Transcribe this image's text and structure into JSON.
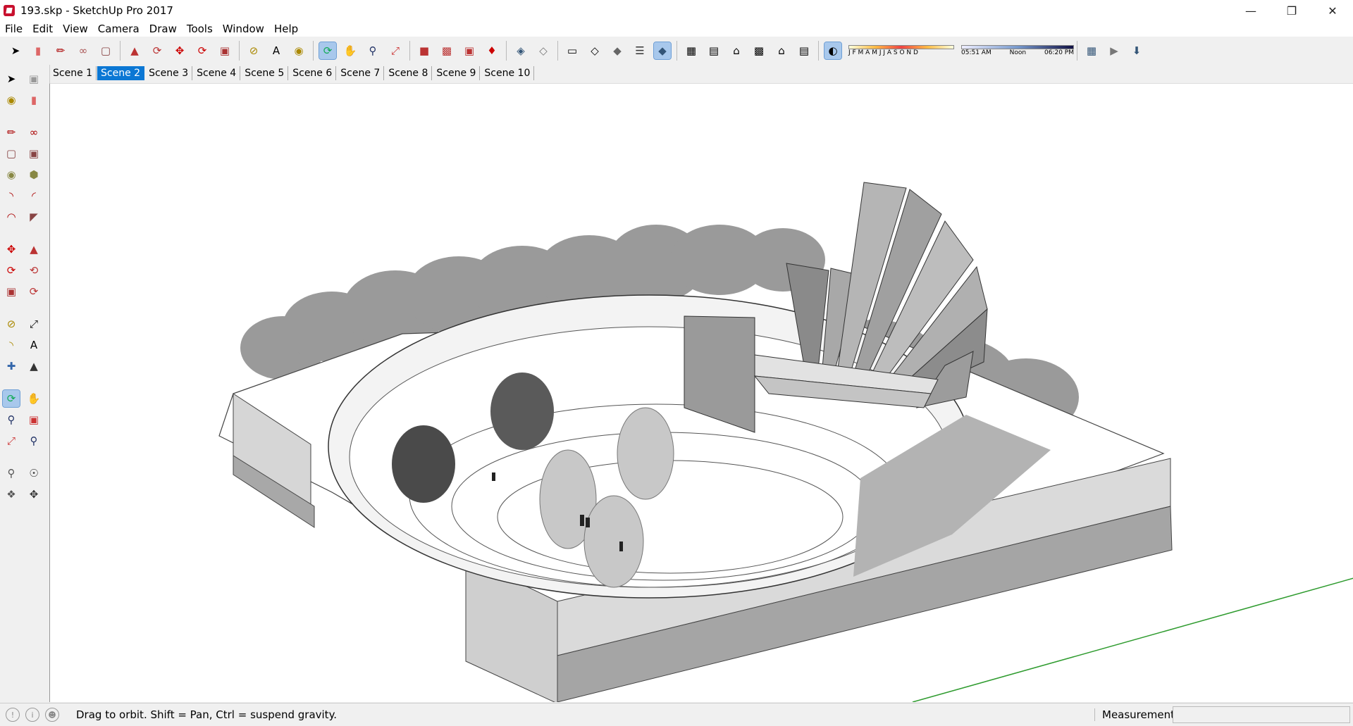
{
  "window": {
    "title": "193.skp - SketchUp Pro 2017"
  },
  "menu": [
    "File",
    "Edit",
    "View",
    "Camera",
    "Draw",
    "Tools",
    "Window",
    "Help"
  ],
  "scenes": {
    "tabs": [
      "Scene 1",
      "Scene 2",
      "Scene 3",
      "Scene 4",
      "Scene 5",
      "Scene 6",
      "Scene 7",
      "Scene 8",
      "Scene 9",
      "Scene 10"
    ],
    "active_index": 1
  },
  "shadow": {
    "months": "J F M A M J J A S O N D",
    "time_start": "05:51 AM",
    "time_noon": "Noon",
    "time_end": "06:20 PM"
  },
  "status": {
    "hint": "Drag to orbit. Shift = Pan, Ctrl = suspend gravity.",
    "measurements_label": "Measurements",
    "measurements_value": ""
  },
  "colors": {
    "active_tab": "#0b77d4",
    "selected_tool": "#a8c8ec",
    "axis_green": "#2e9b2e"
  }
}
